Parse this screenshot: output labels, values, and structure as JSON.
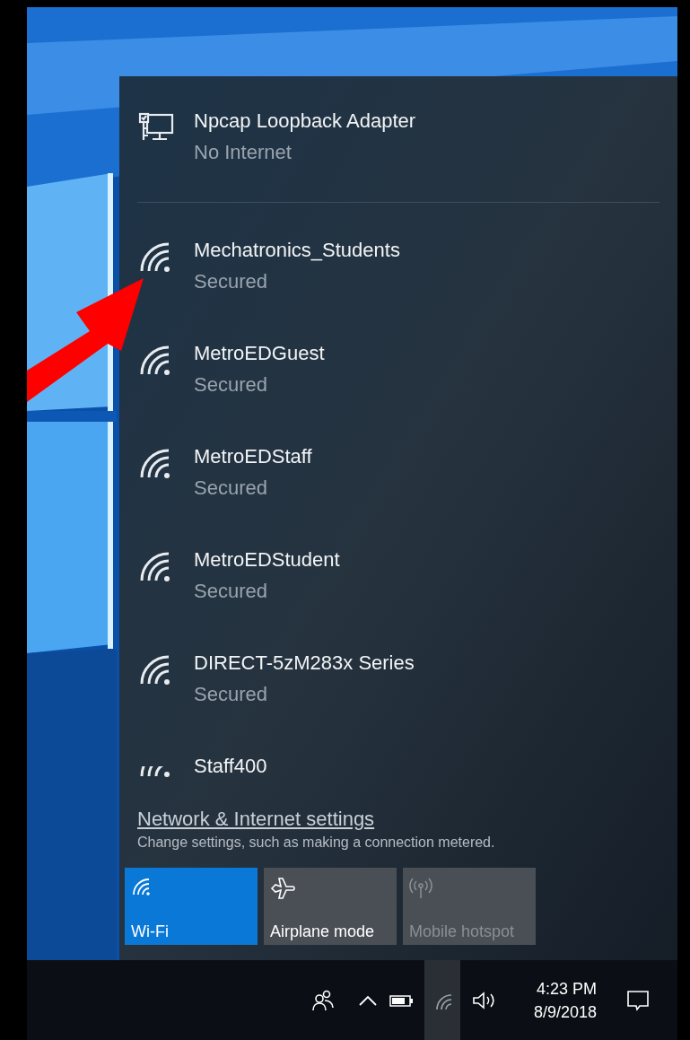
{
  "connections": [
    {
      "kind": "wired",
      "name": "Npcap Loopback Adapter",
      "status": "No Internet"
    },
    {
      "kind": "wifi",
      "name": "Mechatronics_Students",
      "status": "Secured"
    },
    {
      "kind": "wifi",
      "name": "MetroEDGuest",
      "status": "Secured"
    },
    {
      "kind": "wifi",
      "name": "MetroEDStaff",
      "status": "Secured"
    },
    {
      "kind": "wifi",
      "name": "MetroEDStudent",
      "status": "Secured"
    },
    {
      "kind": "wifi",
      "name": "DIRECT-5zM283x Series",
      "status": "Secured"
    },
    {
      "kind": "wifi_partial",
      "name": "Staff400"
    }
  ],
  "settings_link": "Network & Internet settings",
  "settings_hint": "Change settings, such as making a connection metered.",
  "quick_actions": [
    {
      "kind": "wifi",
      "label": "Wi-Fi",
      "on": true,
      "disabled": false
    },
    {
      "kind": "airplane",
      "label": "Airplane mode",
      "on": false,
      "disabled": false
    },
    {
      "kind": "hotspot",
      "label": "Mobile hotspot",
      "on": false,
      "disabled": true
    }
  ],
  "taskbar": {
    "time": "4:23 PM",
    "date": "8/9/2018"
  }
}
